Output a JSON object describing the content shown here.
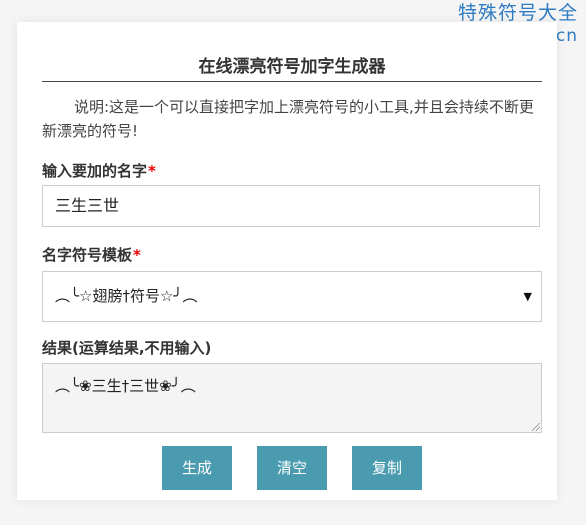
{
  "watermark": {
    "site_name": "特殊符号大全",
    "url": "www.tsfhdq.cn"
  },
  "form": {
    "title": "在线漂亮符号加字生成器",
    "description": "说明:这是一个可以直接把字加上漂亮符号的小工具,并且会持续不断更新漂亮的符号!",
    "name_label": "输入要加的名字",
    "name_required_mark": "*",
    "name_value": "三生三世",
    "template_label": "名字符号模板",
    "template_required_mark": "*",
    "template_selected": "︵╰☆翅膀†符号☆╯︵",
    "result_label": "结果(运算结果,不用输入)",
    "result_value": "︵╰❀三生†三世❀╯︵"
  },
  "buttons": {
    "generate_label": "生成",
    "clear_label": "清空",
    "copy_label": "复制"
  },
  "icons": {
    "dropdown": "dropdown-arrow-icon",
    "resize": "resize-grip-icon"
  },
  "colors": {
    "watermark": "#2e7bc3",
    "button": "#4a9bb0",
    "required": "#e00000"
  }
}
